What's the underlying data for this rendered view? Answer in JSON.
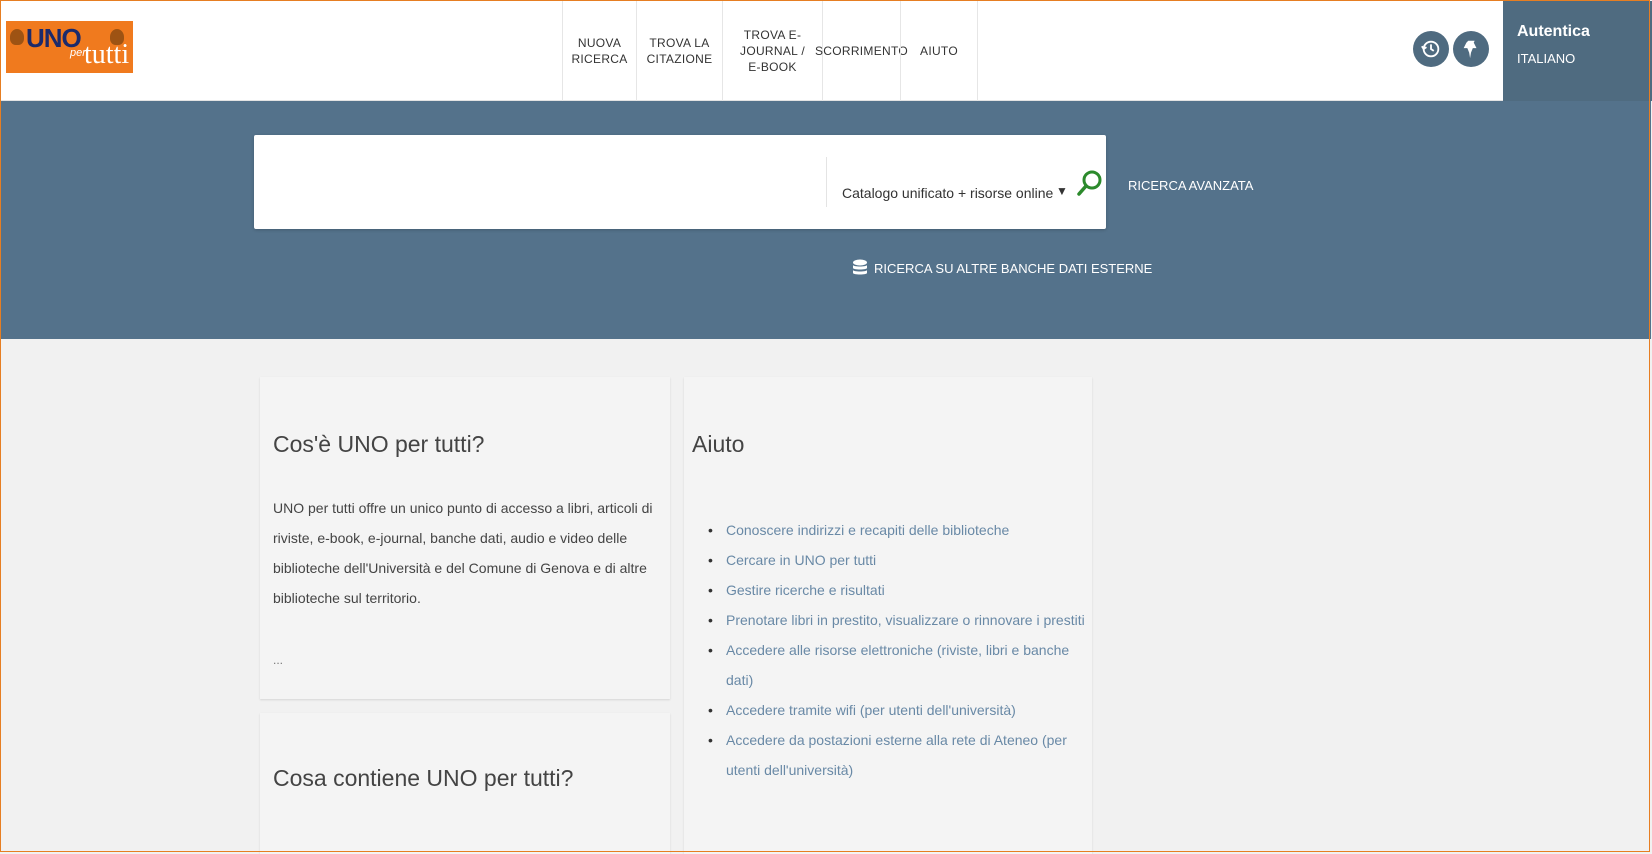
{
  "header": {
    "logo": {
      "uno": "UNO",
      "per": "per",
      "tutti": "tutti"
    },
    "nav": [
      {
        "line1": "NUOVA",
        "line2": "RICERCA"
      },
      {
        "line1": "TROVA LA",
        "line2": "CITAZIONE"
      },
      {
        "line1": "TROVA E-JOURNAL /",
        "line2": "E-BOOK"
      },
      {
        "line1": "SCORRIMENTO",
        "line2": ""
      },
      {
        "line1": "AIUTO",
        "line2": ""
      }
    ],
    "icons": [
      "history-icon",
      "pin-icon"
    ],
    "auth": {
      "login": "Autentica",
      "language": "ITALIANO"
    }
  },
  "search": {
    "placeholder": "",
    "scope": "Catalogo unificato + risorse online",
    "advanced": "RICERCA AVANZATA",
    "external": "RICERCA SU ALTRE BANCHE DATI ESTERNE"
  },
  "cards": {
    "about": {
      "title": "Cos'è UNO per tutti?",
      "text": "UNO per tutti offre un unico punto di accesso a libri, articoli di riviste, e-book, e-journal, banche dati, audio e video delle biblioteche dell'Università e del Comune di Genova e di altre biblioteche sul territorio.",
      "more": "..."
    },
    "contents": {
      "title": "Cosa contiene UNO per tutti?"
    },
    "help": {
      "title": "Aiuto",
      "links": [
        "Conoscere indirizzi e recapiti delle biblioteche",
        "Cercare in UNO per tutti",
        "Gestire ricerche e risultati",
        "Prenotare libri in prestito, visualizzare o rinnovare i prestiti",
        "Accedere alle risorse elettroniche (riviste, libri e banche dati)",
        "Accedere tramite wifi (per utenti dell'università)",
        "Accedere da postazioni esterne alla rete di Ateneo (per utenti dell'università)"
      ]
    }
  },
  "colors": {
    "band": "#54728b",
    "accent": "#f07a1e",
    "link": "#6989a6"
  }
}
